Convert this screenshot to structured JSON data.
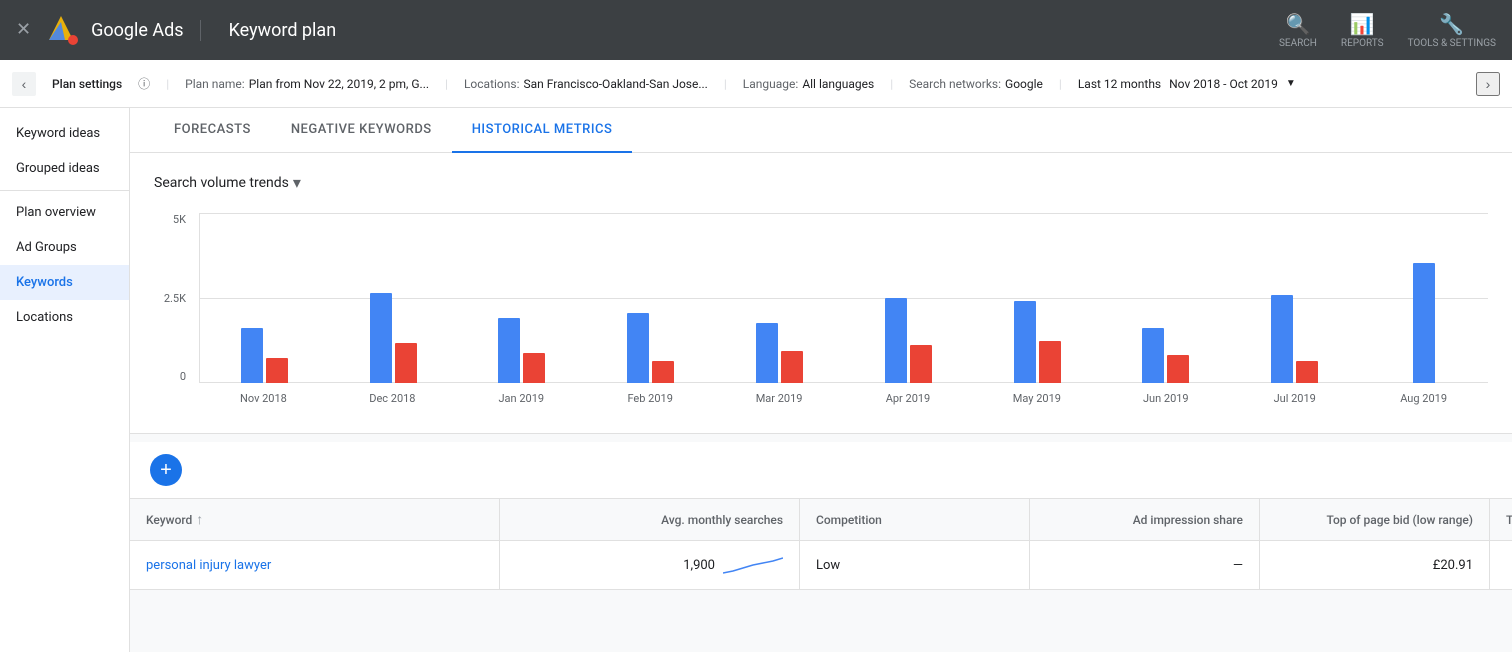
{
  "topnav": {
    "app_name": "Google Ads",
    "page_title": "Keyword plan",
    "search_label": "SEARCH",
    "reports_label": "REPORTS",
    "tools_label": "TOOLS & SETTINGS"
  },
  "plan_settings": {
    "label": "Plan settings",
    "plan_name_label": "Plan name:",
    "plan_name_value": "Plan from Nov 22, 2019, 2 pm, G...",
    "locations_label": "Locations:",
    "locations_value": "San Francisco-Oakland-San Jose...",
    "language_label": "Language:",
    "language_value": "All languages",
    "networks_label": "Search networks:",
    "networks_value": "Google",
    "date_range_label": "Last 12 months",
    "date_range_value": "Nov 2018 - Oct 2019"
  },
  "sidebar": {
    "items": [
      {
        "label": "Keyword ideas",
        "active": false
      },
      {
        "label": "Grouped ideas",
        "active": false
      },
      {
        "label": "Plan overview",
        "active": false
      },
      {
        "label": "Ad Groups",
        "active": false
      },
      {
        "label": "Keywords",
        "active": true
      },
      {
        "label": "Locations",
        "active": false
      }
    ]
  },
  "tabs": [
    {
      "label": "FORECASTS",
      "active": false
    },
    {
      "label": "NEGATIVE KEYWORDS",
      "active": false
    },
    {
      "label": "HISTORICAL METRICS",
      "active": true
    }
  ],
  "chart": {
    "title": "Search volume trends",
    "y_labels": [
      "5K",
      "2.5K",
      "0"
    ],
    "months": [
      {
        "label": "Nov 2018",
        "blue": 55,
        "red": 25
      },
      {
        "label": "Dec 2018",
        "blue": 90,
        "red": 40
      },
      {
        "label": "Jan 2019",
        "blue": 65,
        "red": 30
      },
      {
        "label": "Feb 2019",
        "blue": 70,
        "red": 22
      },
      {
        "label": "Mar 2019",
        "blue": 60,
        "red": 32
      },
      {
        "label": "Apr 2019",
        "blue": 85,
        "red": 38
      },
      {
        "label": "May 2019",
        "blue": 82,
        "red": 42
      },
      {
        "label": "Jun 2019",
        "blue": 55,
        "red": 28
      },
      {
        "label": "Jul 2019",
        "blue": 88,
        "red": 22
      },
      {
        "label": "Aug 2019",
        "blue": 120,
        "red": 0
      }
    ]
  },
  "table": {
    "headers": {
      "keyword": "Keyword",
      "avg_monthly": "Avg. monthly searches",
      "competition": "Competition",
      "ad_impression": "Ad impression share",
      "top_bid_low": "Top of page bid (low range)",
      "top_label": "Top"
    },
    "rows": [
      {
        "keyword": "personal injury lawyer",
        "avg_monthly": "1,900",
        "competition": "Low",
        "ad_impression": "—",
        "top_bid_low": "£20.91",
        "top": ""
      }
    ]
  }
}
